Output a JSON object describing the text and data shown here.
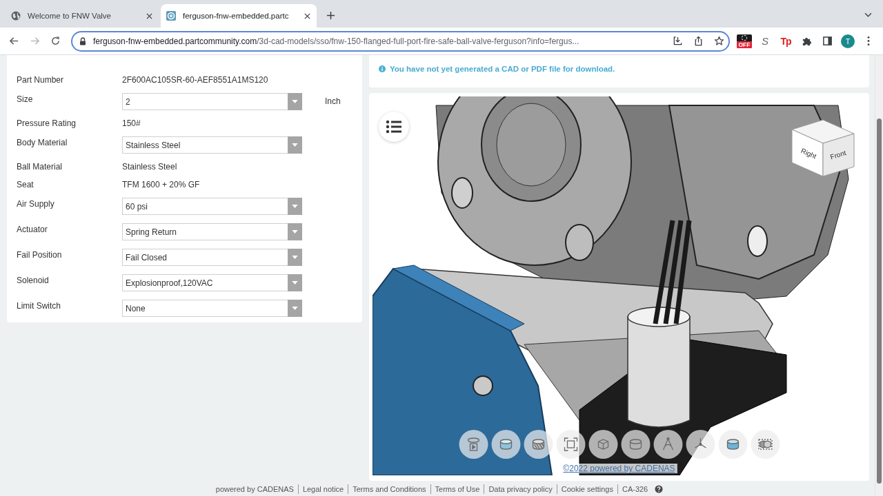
{
  "browser": {
    "tabs": [
      {
        "title": "Welcome to FNW Valve",
        "kind": "globe",
        "selected": false
      },
      {
        "title": "ferguson-fnw-embedded.partc",
        "kind": "site",
        "selected": true
      }
    ],
    "nav": [
      {
        "kind": "back",
        "disabled": false
      },
      {
        "kind": "forward",
        "disabled": true
      },
      {
        "kind": "reload",
        "disabled": false
      }
    ],
    "address": {
      "domain": "ferguson-fnw-embedded.partcommunity.com",
      "path": "/3d-cad-models/sso/fnw-150-flanged-full-port-fire-safe-ball-valve-ferguson?info=fergus..."
    },
    "extensions": [
      {
        "kind": "badge",
        "label": "OFF"
      },
      {
        "kind": "letter",
        "label": "S"
      },
      {
        "kind": "logo",
        "label": "Tp"
      },
      {
        "kind": "puzzle"
      },
      {
        "kind": "sidebar"
      }
    ],
    "profile": {
      "initial": "T"
    }
  },
  "configurator": {
    "fields": [
      {
        "label": "Part Number",
        "kind": "text",
        "value": "2F600AC105SR-60-AEF8551A1MS120"
      },
      {
        "label": "Size",
        "kind": "select",
        "value": "2",
        "unit": "Inch"
      },
      {
        "label": "Pressure Rating",
        "kind": "text",
        "value": "150#"
      },
      {
        "label": "Body Material",
        "kind": "select",
        "value": "Stainless Steel"
      },
      {
        "label": "Ball Material",
        "kind": "text",
        "value": "Stainless Steel"
      },
      {
        "label": "Seat",
        "kind": "text",
        "value": "TFM 1600 + 20% GF"
      },
      {
        "label": "Air Supply",
        "kind": "select",
        "value": "60 psi"
      },
      {
        "label": "Actuator",
        "kind": "select",
        "value": "Spring Return"
      },
      {
        "label": "Fail Position",
        "kind": "select",
        "value": "Fail Closed"
      },
      {
        "label": "Solenoid",
        "kind": "select",
        "value": "Explosionproof,120VAC"
      },
      {
        "label": "Limit Switch",
        "kind": "select",
        "value": "None"
      }
    ]
  },
  "notice": {
    "text": "You have not yet generated a CAD or PDF file for download."
  },
  "viewer": {
    "view_cube": {
      "left_face": "Right",
      "right_face": "Front"
    },
    "toolbar": [
      {
        "kind": "turntable"
      },
      {
        "kind": "shaded"
      },
      {
        "kind": "section"
      },
      {
        "kind": "fit"
      },
      {
        "kind": "wireframe"
      },
      {
        "kind": "outline"
      },
      {
        "kind": "measure"
      },
      {
        "kind": "axes"
      },
      {
        "kind": "material"
      },
      {
        "kind": "explode"
      }
    ],
    "credit": "©2022 powered by CADENAS"
  },
  "footer": {
    "links": [
      "powered by CADENAS",
      "Legal notice",
      "Terms and Conditions",
      "Terms of Use",
      "Data privacy policy",
      "Cookie settings",
      "CA-326"
    ]
  }
}
